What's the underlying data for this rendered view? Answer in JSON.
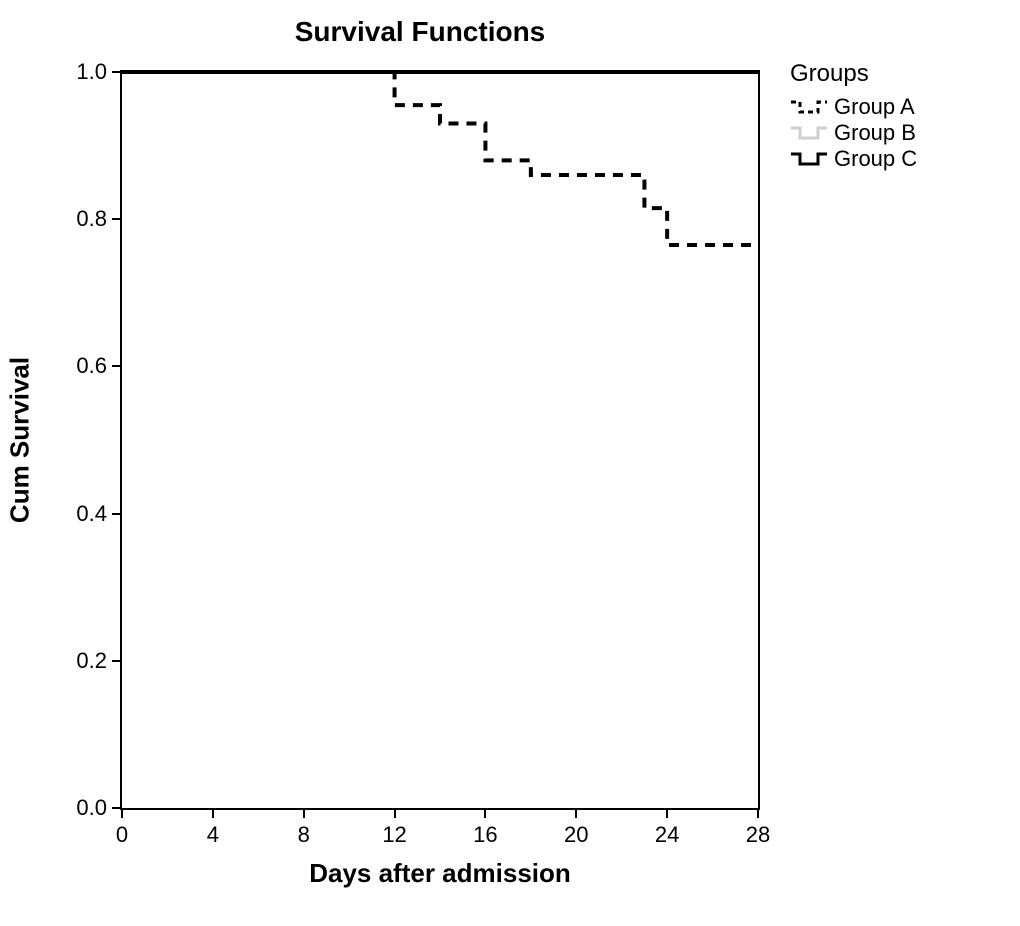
{
  "chart_data": {
    "type": "line",
    "title": "Survival Functions",
    "xlabel": "Days after admission",
    "ylabel": "Cum Survival",
    "xlim": [
      0,
      28
    ],
    "ylim": [
      0.0,
      1.0
    ],
    "xticks": [
      0,
      4,
      8,
      12,
      16,
      20,
      24,
      28
    ],
    "yticks": [
      0.0,
      0.2,
      0.4,
      0.6,
      0.8,
      1.0
    ],
    "series": [
      {
        "name": "Group A",
        "style": "dashed-black",
        "step_points": [
          {
            "x": 0,
            "y": 1.0
          },
          {
            "x": 12,
            "y": 1.0
          },
          {
            "x": 12,
            "y": 0.955
          },
          {
            "x": 14,
            "y": 0.955
          },
          {
            "x": 14,
            "y": 0.93
          },
          {
            "x": 16,
            "y": 0.93
          },
          {
            "x": 16,
            "y": 0.88
          },
          {
            "x": 18,
            "y": 0.88
          },
          {
            "x": 18,
            "y": 0.86
          },
          {
            "x": 23,
            "y": 0.86
          },
          {
            "x": 23,
            "y": 0.815
          },
          {
            "x": 24,
            "y": 0.815
          },
          {
            "x": 24,
            "y": 0.765
          },
          {
            "x": 28,
            "y": 0.765
          }
        ]
      },
      {
        "name": "Group B",
        "style": "light-gray",
        "step_points": [
          {
            "x": 0,
            "y": 1.0
          },
          {
            "x": 28,
            "y": 1.0
          }
        ]
      },
      {
        "name": "Group C",
        "style": "solid-black",
        "step_points": [
          {
            "x": 0,
            "y": 1.0
          },
          {
            "x": 28,
            "y": 1.0
          }
        ]
      }
    ],
    "legend": {
      "title": "Groups",
      "position": "right",
      "entries": [
        "Group A",
        "Group B",
        "Group C"
      ]
    }
  }
}
